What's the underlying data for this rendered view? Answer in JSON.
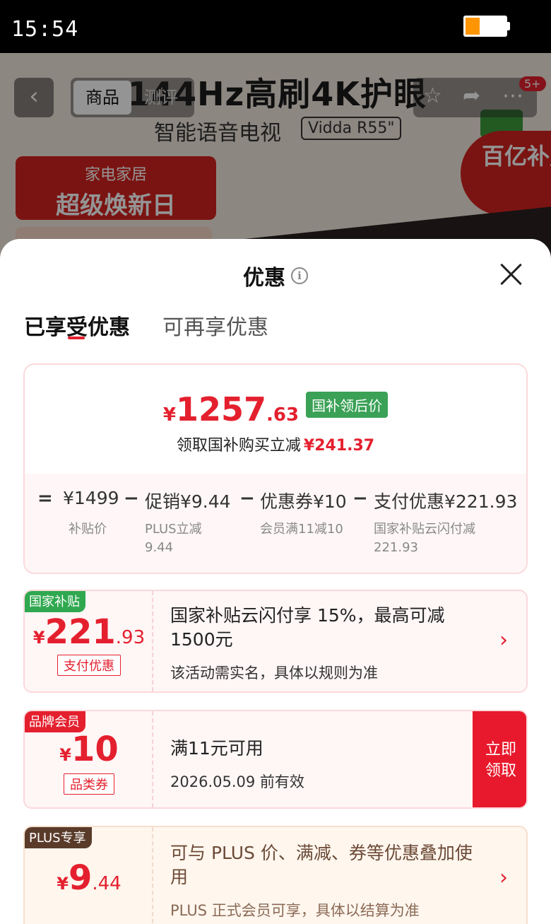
{
  "status_bar": {
    "time": "15:54",
    "battery_level": 0.35,
    "battery_color": "#ff9500"
  },
  "product_header": {
    "headline": "144Hz高刷4K护眼",
    "subheadline": "智能语音电视",
    "model": "Vidda R55\"",
    "banner_line1": "家电家居",
    "banner_line2": "超级焕新日",
    "subsidy_badge": "百亿补贴",
    "tabs": [
      "商品",
      "测评"
    ],
    "notification_count": "5+"
  },
  "sheet": {
    "title": "优惠",
    "tabs": [
      {
        "label": "已享受优惠",
        "active": true
      },
      {
        "label": "可再享优惠",
        "active": false
      }
    ]
  },
  "summary": {
    "currency": "¥",
    "price_int": "1257",
    "price_dec": ".63",
    "price_tag": "国补领后价",
    "save_text": "领取国补购买立减",
    "save_amount": "¥241.37",
    "breakdown": [
      {
        "op": "=",
        "value": "¥1499",
        "note": "补贴价"
      },
      {
        "op": "−",
        "value": "促销¥9.44",
        "note": "PLUS立减\n9.44"
      },
      {
        "op": "−",
        "value": "优惠券¥10",
        "note": "会员满11减10"
      },
      {
        "op": "−",
        "value": "支付优惠¥221.93",
        "note": "国家补贴云闪付减\n221.93"
      }
    ]
  },
  "coupons": [
    {
      "corner_tag": "国家补贴",
      "corner_color": "#2fa84f",
      "currency": "¥",
      "amount_int": "221",
      "amount_dec": ".93",
      "type_tag": "支付优惠",
      "title": "国家补贴云闪付享 15%，最高可减 1500元",
      "subtitle": "该活动需实名，具体以规则为准",
      "action": "chevron-right"
    },
    {
      "corner_tag": "品牌会员",
      "corner_color": "#e4202e",
      "currency": "¥",
      "amount_int": "10",
      "amount_dec": "",
      "type_tag": "品类券",
      "title": "满11元可用",
      "subtitle": "2026.05.09 前有效",
      "action_label": "立即领取"
    },
    {
      "corner_tag": "PLUS专享",
      "corner_color": "#5a3b2a",
      "currency": "¥",
      "amount_int": "9",
      "amount_dec": ".44",
      "title": "可与 PLUS 价、满减、券等优惠叠加使用",
      "subtitle": "PLUS 正式会员可享，具体以结算为准",
      "action": "chevron-right"
    }
  ],
  "colors": {
    "accent": "#e4202e",
    "green": "#3aa156"
  }
}
